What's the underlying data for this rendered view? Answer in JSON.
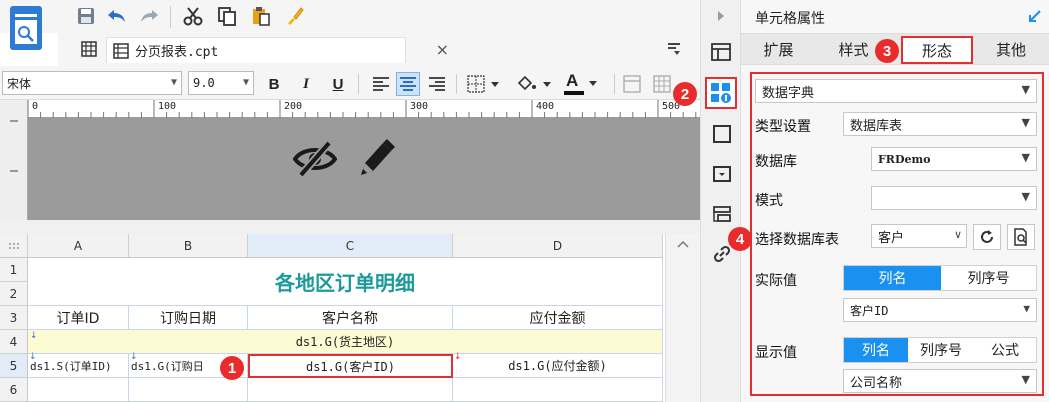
{
  "toolbar": {
    "icons": [
      "save-icon",
      "undo-icon",
      "redo-icon",
      "cut-icon",
      "copy-icon",
      "paste-icon",
      "format-brush-icon"
    ]
  },
  "tab": {
    "label": "分页报表.cpt",
    "close": "×"
  },
  "format": {
    "font": "宋体",
    "size": "9.0",
    "bold": "B",
    "italic": "I",
    "underline": "U",
    "fontcolor": "A"
  },
  "ruler": {
    "marks": [
      "0",
      "100",
      "200",
      "300",
      "400",
      "500"
    ]
  },
  "grid": {
    "columns": [
      "A",
      "B",
      "C",
      "D"
    ],
    "rows": [
      "1",
      "2",
      "3",
      "4",
      "5",
      "6"
    ],
    "title": "各地区订单明细",
    "headers": [
      "订单ID",
      "订购日期",
      "客户名称",
      "应付金额"
    ],
    "group_cell": "ds1.G(货主地区)",
    "data_cells": [
      "ds1.S(订单ID)",
      "ds1.G(订购日",
      "ds1.G(客户ID)",
      "ds1.G(应付金额)"
    ]
  },
  "panel": {
    "title": "单元格属性",
    "tabs": [
      "扩展",
      "样式",
      "形态",
      "其他"
    ],
    "active_tab": "形态",
    "form_type": "数据字典",
    "type_label": "类型设置",
    "type_value": "数据库表",
    "db_label": "数据库",
    "db_value": "FRDemo",
    "mode_label": "模式",
    "mode_value": "",
    "table_label": "选择数据库表",
    "table_value": "客户",
    "actual_label": "实际值",
    "actual_options": [
      "列名",
      "列序号"
    ],
    "actual_value": "客户ID",
    "display_label": "显示值",
    "display_options": [
      "列名",
      "列序号",
      "公式"
    ],
    "display_value": "公司名称"
  },
  "badges": [
    "1",
    "2",
    "3",
    "4"
  ],
  "colors": {
    "accent": "#1a90f0",
    "title_teal": "#1a9a9a",
    "badge_red": "#e82b2b",
    "group_row": "#fdfbd3"
  }
}
